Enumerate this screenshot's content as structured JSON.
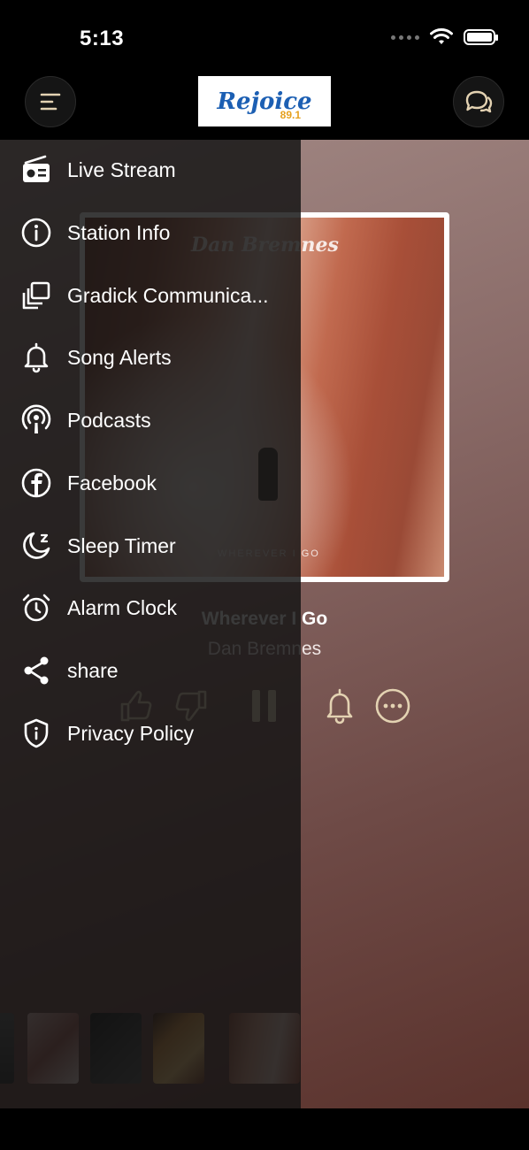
{
  "status": {
    "time": "5:13"
  },
  "header": {
    "logo": {
      "name": "Rejoice",
      "frequency": "89.1"
    },
    "menu_icon": "menu-icon",
    "chat_icon": "chat-bubbles-icon"
  },
  "now_playing": {
    "album_artist_text": "Dan Bremnes",
    "album_title_text": "WHEREVER I GO",
    "title": "Wherever I Go",
    "artist": "Dan Bremnes"
  },
  "controls": [
    {
      "name": "thumbs-up",
      "icon": "thumbs-up-icon"
    },
    {
      "name": "thumbs-down",
      "icon": "thumbs-down-icon"
    },
    {
      "name": "pause",
      "icon": "pause-icon"
    },
    {
      "name": "song-alert",
      "icon": "bell-icon"
    },
    {
      "name": "more",
      "icon": "more-icon"
    }
  ],
  "drawer": {
    "items": [
      {
        "label": "Live Stream",
        "icon": "radio-icon"
      },
      {
        "label": "Station Info",
        "icon": "info-icon"
      },
      {
        "label": "Gradick Communica...",
        "icon": "copy-icon"
      },
      {
        "label": "Song Alerts",
        "icon": "bell-icon"
      },
      {
        "label": "Podcasts",
        "icon": "podcast-icon"
      },
      {
        "label": "Facebook",
        "icon": "facebook-icon"
      },
      {
        "label": "Sleep Timer",
        "icon": "moon-icon"
      },
      {
        "label": "Alarm Clock",
        "icon": "alarm-clock-icon"
      },
      {
        "label": "share",
        "icon": "share-icon"
      },
      {
        "label": "Privacy Policy",
        "icon": "shield-icon"
      }
    ]
  },
  "colors": {
    "accent": "#e3d2b2",
    "logo_blue": "#1c5fb3",
    "logo_gold": "#e6a11e"
  }
}
